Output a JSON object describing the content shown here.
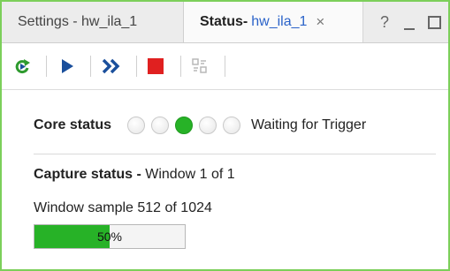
{
  "tabs": {
    "settings": {
      "label": "Settings - hw_ila_1"
    },
    "status": {
      "name": "Status",
      "separator": "-",
      "target": "hw_ila_1",
      "close": "×"
    },
    "help": "?"
  },
  "toolbar": {
    "buttons": [
      {
        "icon": "auto-rerun-icon",
        "color": "#2e9a2e"
      },
      {
        "icon": "run-trigger-icon",
        "color": "#1a4f9c"
      },
      {
        "icon": "run-immediate-icon",
        "color": "#1a4f9c"
      },
      {
        "icon": "stop-icon",
        "color": "#e02020"
      },
      {
        "icon": "capture-disabled-icon",
        "color": "#b8b8b8"
      }
    ]
  },
  "core_status": {
    "label": "Core status",
    "leds": [
      false,
      false,
      true,
      false,
      false
    ],
    "text": "Waiting for Trigger"
  },
  "capture_status": {
    "label": "Capture status -",
    "window": "Window 1 of 1"
  },
  "window_sample": "Window sample 512 of 1024",
  "progress": {
    "percent": 50,
    "label": "50%",
    "color": "#27b227"
  }
}
